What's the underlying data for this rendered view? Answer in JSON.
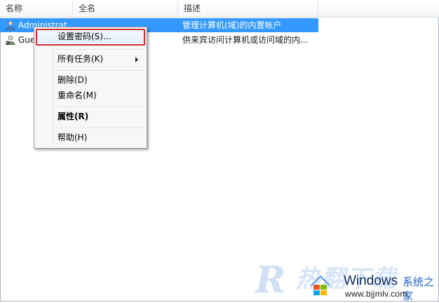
{
  "columns": [
    "名称",
    "全名",
    "描述"
  ],
  "rows": [
    {
      "name": "Administrat",
      "fullname": "",
      "description": "管理计算机(域)的内置帐户",
      "icon": "user-admin-icon",
      "selected": true
    },
    {
      "name": "Gue",
      "fullname": "",
      "description": "供来宾访问计算机或访问域的内...",
      "icon": "user-guest-icon",
      "selected": false
    }
  ],
  "context_menu": {
    "set_password": "设置密码(S)...",
    "all_tasks": "所有任务(K)",
    "delete": "删除(D)",
    "rename": "重命名(M)",
    "properties": "属性(R)",
    "help": "帮助(H)"
  },
  "watermark": {
    "letter": "R",
    "cn": "热翻下载",
    "brand": "Windows",
    "brand_cn": "系统之家",
    "url": "www.bjjmlv.com"
  },
  "colors": {
    "selection": "#3399ff",
    "highlight_border": "#d32f2f"
  }
}
